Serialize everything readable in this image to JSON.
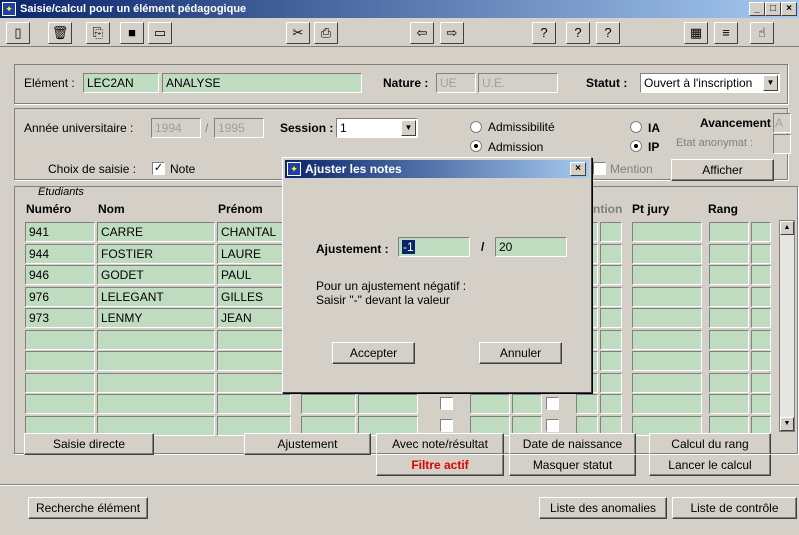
{
  "window": {
    "title": "Saisie/calcul pour un élément pédagogique"
  },
  "element": {
    "label": "Elément :",
    "code": "LEC2AN",
    "name": "ANALYSE",
    "nature_label": "Nature :",
    "nature_code": "UE",
    "nature_name": "U.E.",
    "statut_label": "Statut :",
    "statut_value": "Ouvert à l'inscription"
  },
  "session_area": {
    "annee_label": "Année universitaire :",
    "annee_from": "1994",
    "annee_sep": "/",
    "annee_to": "1995",
    "session_label": "Session :",
    "session_value": "1",
    "admissibilite": "Admissibilité",
    "admission": "Admission",
    "ia": "IA",
    "ip": "IP",
    "avancement_label": "Avancement :",
    "avancement_value": "A",
    "etat_label": "Etat anonymat :",
    "choix_label": "Choix de saisie :",
    "note_label": "Note",
    "mention_label": "Mention",
    "afficher": "Afficher"
  },
  "table": {
    "group_label": "Etudiants",
    "headers": {
      "numero": "Numéro",
      "nom": "Nom",
      "prenom": "Prénom",
      "mention": "ntion",
      "ptjury": "Pt jury",
      "rang": "Rang"
    },
    "rows": [
      {
        "numero": "941",
        "nom": "CARRE",
        "prenom": "CHANTAL"
      },
      {
        "numero": "944",
        "nom": "FOSTIER",
        "prenom": "LAURE"
      },
      {
        "numero": "946",
        "nom": "GODET",
        "prenom": "PAUL"
      },
      {
        "numero": "976",
        "nom": "LELEGANT",
        "prenom": "GILLES"
      },
      {
        "numero": "973",
        "nom": "LENMY",
        "prenom": "JEAN"
      }
    ]
  },
  "buttons": {
    "saisie_directe": "Saisie directe",
    "ajustement": "Ajustement",
    "avec_note": "Avec note/résultat",
    "date_naissance": "Date de naissance",
    "calcul_rang": "Calcul du rang",
    "filtre_actif": "Filtre actif",
    "masquer_statut": "Masquer statut",
    "lancer_calcul": "Lancer le calcul",
    "recherche_element": "Recherche élément",
    "liste_anomalies": "Liste des anomalies",
    "liste_controle": "Liste de contrôle"
  },
  "dialog": {
    "title": "Ajuster les notes",
    "ajustement_label": "Ajustement :",
    "value": "-1",
    "sep": "/",
    "max": "20",
    "hint1": "Pour un ajustement négatif :",
    "hint2": "Saisir \"-\" devant la valeur",
    "accepter": "Accepter",
    "annuler": "Annuler"
  }
}
